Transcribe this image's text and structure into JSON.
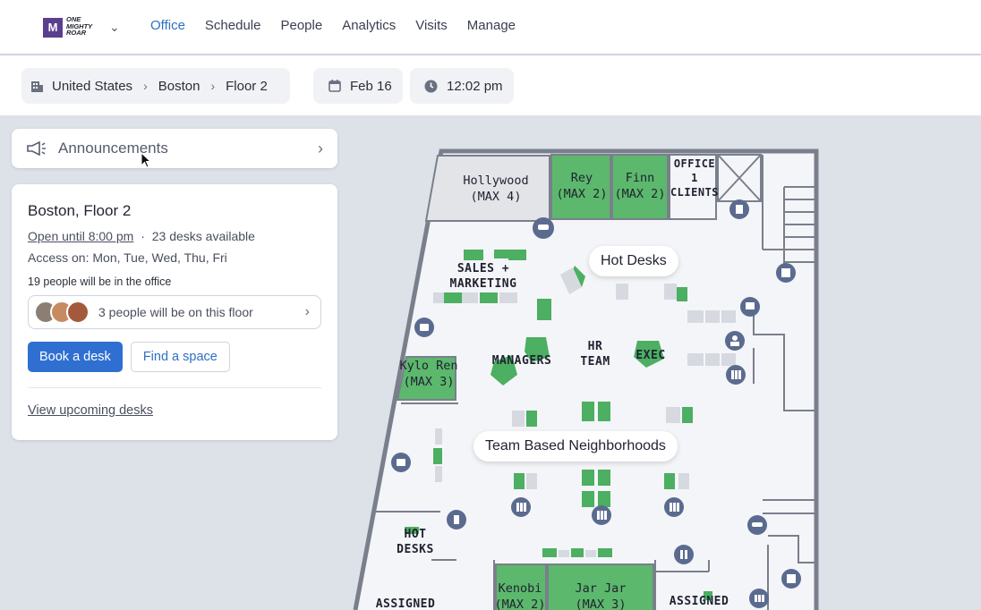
{
  "nav": {
    "logo_text": "ONE MIGHTY ROAR",
    "links": [
      {
        "label": "Office",
        "active": true
      },
      {
        "label": "Schedule"
      },
      {
        "label": "People"
      },
      {
        "label": "Analytics"
      },
      {
        "label": "Visits"
      },
      {
        "label": "Manage"
      }
    ]
  },
  "subbar": {
    "breadcrumb": [
      "United States",
      "Boston",
      "Floor 2"
    ],
    "date": "Feb 16",
    "time": "12:02 pm"
  },
  "announcements": {
    "label": "Announcements"
  },
  "info": {
    "title": "Boston, Floor 2",
    "open_until": "Open until 8:00 pm",
    "separator": "·",
    "desks_available": "23 desks available",
    "access": "Access on: Mon, Tue, Wed, Thu, Fri",
    "people_office": "19 people will be in the office",
    "people_floor": "3 people will be on this floor",
    "book_desk": "Book a desk",
    "find_space": "Find a space",
    "view_upcoming": "View upcoming desks"
  },
  "map": {
    "rooms": {
      "hollywood": "Hollywood\n(MAX 4)",
      "rey": "Rey\n(MAX 2)",
      "finn": "Finn\n(MAX 2)",
      "office1": "OFFICE\n1\nCLIENTS",
      "kylo": "Kylo Ren\n(MAX 3)",
      "kenobi": "Kenobi\n(MAX 2)",
      "jarjar": "Jar Jar\n(MAX 3)"
    },
    "zones": {
      "sales": "SALES +\nMARKETING",
      "managers": "MANAGERS",
      "hr": "HR\nTEAM",
      "exec": "EXEC",
      "hot": "HOT\nDESKS",
      "assigned_left": "ASSIGNED",
      "assigned_right": "ASSIGNED"
    },
    "bubbles": {
      "hot_desks": "Hot Desks",
      "team_based": "Team Based Neighborhoods"
    }
  },
  "colors": {
    "accent": "#2f6fd1",
    "desk_green": "#4caf62",
    "room_green": "#5cb86c",
    "wall": "#7a7f8c",
    "icon_blue": "#5b6b8f"
  }
}
